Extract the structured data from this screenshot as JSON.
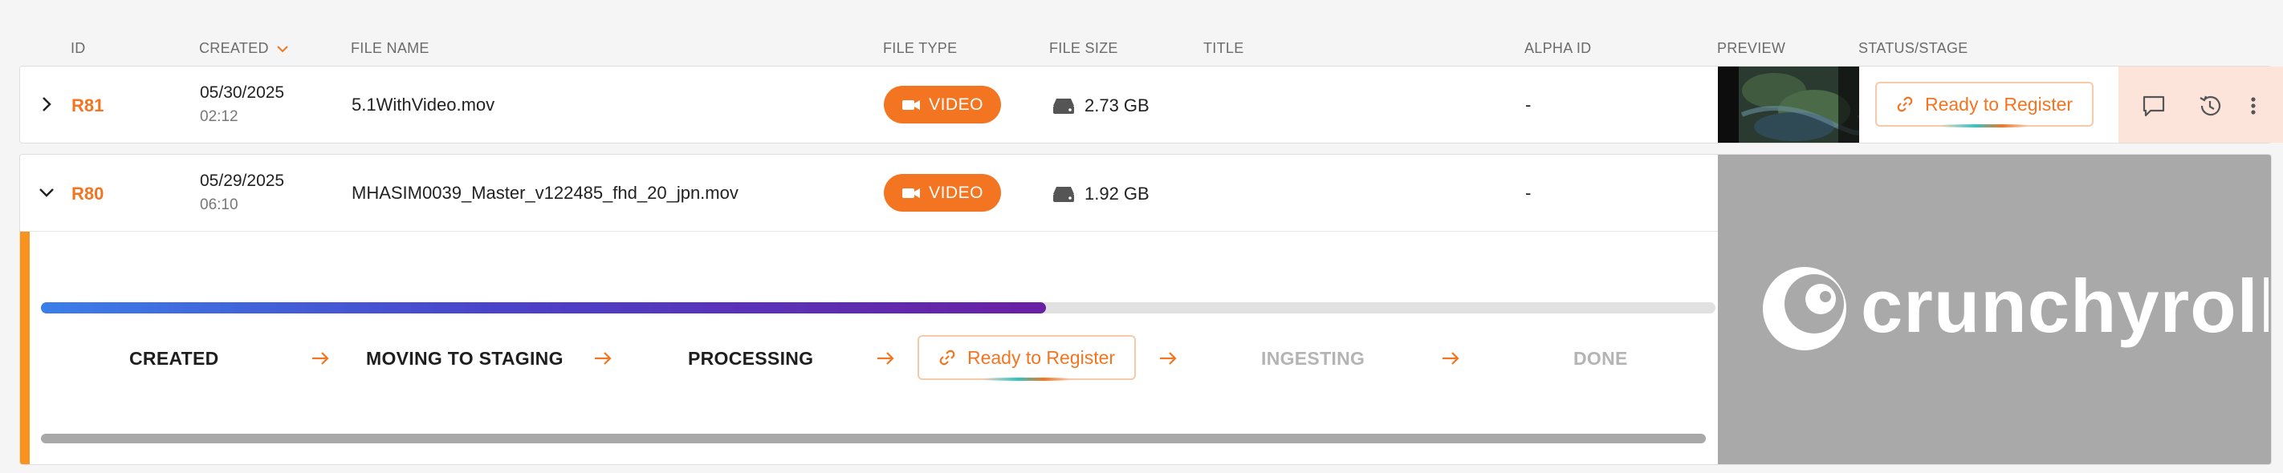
{
  "columns": {
    "id": "ID",
    "created": "CREATED",
    "file_name": "FILE NAME",
    "file_type": "FILE TYPE",
    "file_size": "FILE SIZE",
    "title": "TITLE",
    "alpha_id": "ALPHA ID",
    "preview": "PREVIEW",
    "status": "STATUS/STAGE"
  },
  "sort": {
    "column": "created",
    "direction": "descending",
    "icon": "chevron-down-icon"
  },
  "colors": {
    "accent": "#f47521",
    "row_highlight": "#fde4da",
    "left_accent": "#f7931e",
    "progress_start": "#3b7ee8",
    "progress_end": "#6a1fa3"
  },
  "rows": [
    {
      "id": "R81",
      "date": "05/30/2025",
      "time": "02:12",
      "file_name": "5.1WithVideo.mov",
      "file_type": "VIDEO",
      "file_size": "2.73 GB",
      "title": "",
      "alpha_id": "-",
      "status": "Ready to Register",
      "expanded": false
    },
    {
      "id": "R80",
      "date": "05/29/2025",
      "time": "06:10",
      "file_name": "MHASIM0039_Master_v122485_fhd_20_jpn.mov",
      "file_type": "VIDEO",
      "file_size": "1.92 GB",
      "title": "",
      "alpha_id": "-",
      "expanded": true,
      "preview_brand": "crunchyroll"
    }
  ],
  "stages": {
    "created": "CREATED",
    "moving": "MOVING TO STAGING",
    "processing": "PROCESSING",
    "ready": "Ready to Register",
    "ingesting": "INGESTING",
    "done": "DONE"
  },
  "progress_fraction": 0.6
}
